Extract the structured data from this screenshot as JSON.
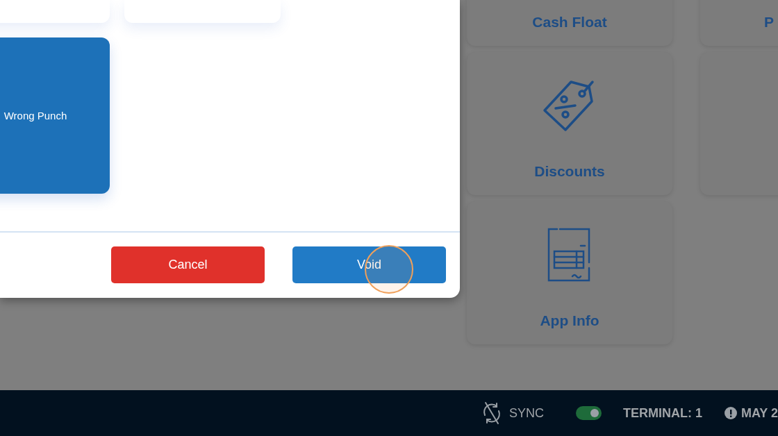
{
  "dialog": {
    "reasons": [
      {
        "selected": false
      },
      {
        "selected": false
      },
      {
        "label": "Wrong Punch",
        "selected": true
      }
    ],
    "buttons": [
      {
        "label": "Cancel",
        "kind": "cancel"
      },
      {
        "label": "Void",
        "kind": "confirm"
      }
    ]
  },
  "tiles": [
    {
      "label": "Cash Float",
      "kind": "plain"
    },
    {
      "label": "P",
      "kind": "partial"
    },
    {
      "label": "Discounts",
      "kind": "discount"
    },
    {
      "kind": "blank"
    },
    {
      "label": "App Info",
      "kind": "receipt"
    }
  ],
  "status_bar": {
    "sync": "SYNC",
    "toggle": {
      "on": true
    },
    "terminal": "TERMINAL: 1",
    "date": "MAY 2"
  }
}
